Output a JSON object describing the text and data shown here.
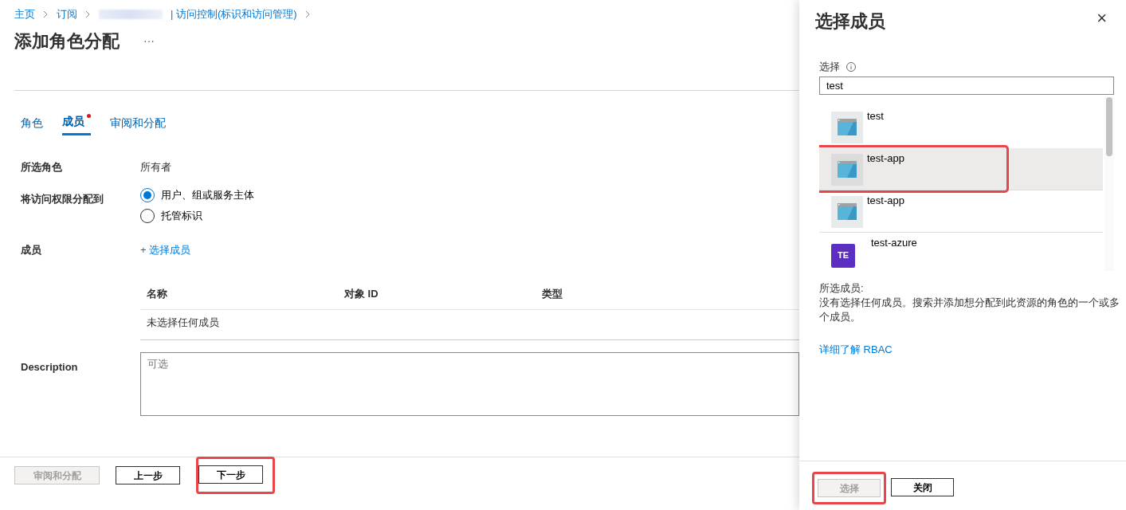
{
  "breadcrumb": [
    {
      "label": "主页",
      "kind": "link"
    },
    {
      "label": "订阅",
      "kind": "link"
    },
    {
      "kind": "redacted"
    },
    {
      "label": "| 访问控制(标识和访问管理)",
      "kind": "link"
    }
  ],
  "title": "添加角色分配",
  "more": "···",
  "tabs": [
    {
      "label": "角色",
      "selected": false,
      "required": false
    },
    {
      "label": "成员",
      "selected": true,
      "required": true
    },
    {
      "label": "审阅和分配",
      "selected": false,
      "required": false
    }
  ],
  "fields": [
    {
      "kind": "text",
      "label": "所选角色",
      "value": "所有者"
    },
    {
      "kind": "radio",
      "label": "将访问权限分配到",
      "options": [
        {
          "label": "用户、组或服务主体",
          "selected": true
        },
        {
          "label": "托管标识",
          "selected": false
        }
      ]
    },
    {
      "kind": "link",
      "label": "成员",
      "icon": "+",
      "value": "选择成员"
    }
  ],
  "members_table": {
    "columns": [
      "名称",
      "对象 ID",
      "类型"
    ],
    "empty": "未选择任何成员"
  },
  "description": {
    "label": "Description",
    "placeholder": "可选"
  },
  "footer_buttons": [
    {
      "label": "审阅和分配",
      "disabled": true,
      "highlighted": false
    },
    {
      "label": "上一步",
      "disabled": false,
      "highlighted": false
    },
    {
      "label": "下一步",
      "disabled": false,
      "highlighted": true
    }
  ],
  "panel": {
    "title": "选择成员",
    "close": "×",
    "search_label": "选择",
    "search_value": "test",
    "results": [
      {
        "name": "test",
        "kind": "app",
        "selected": false,
        "highlighted": false
      },
      {
        "name": "test-app",
        "kind": "app",
        "selected": true,
        "highlighted": true
      },
      {
        "name": "test-app",
        "kind": "app",
        "selected": false,
        "highlighted": false
      },
      {
        "name": "test-azure",
        "kind": "initials",
        "initials": "TE",
        "color": "#5c2fc2",
        "selected": false,
        "highlighted": false
      }
    ],
    "selected_label": "所选成员:",
    "selected_text": "没有选择任何成员。搜索并添加想分配到此资源的角色的一个或多个成员。",
    "learn_link": "详细了解 RBAC",
    "buttons": [
      {
        "label": "选择",
        "disabled": true,
        "highlighted": true
      },
      {
        "label": "关闭",
        "disabled": false,
        "highlighted": false
      }
    ]
  }
}
